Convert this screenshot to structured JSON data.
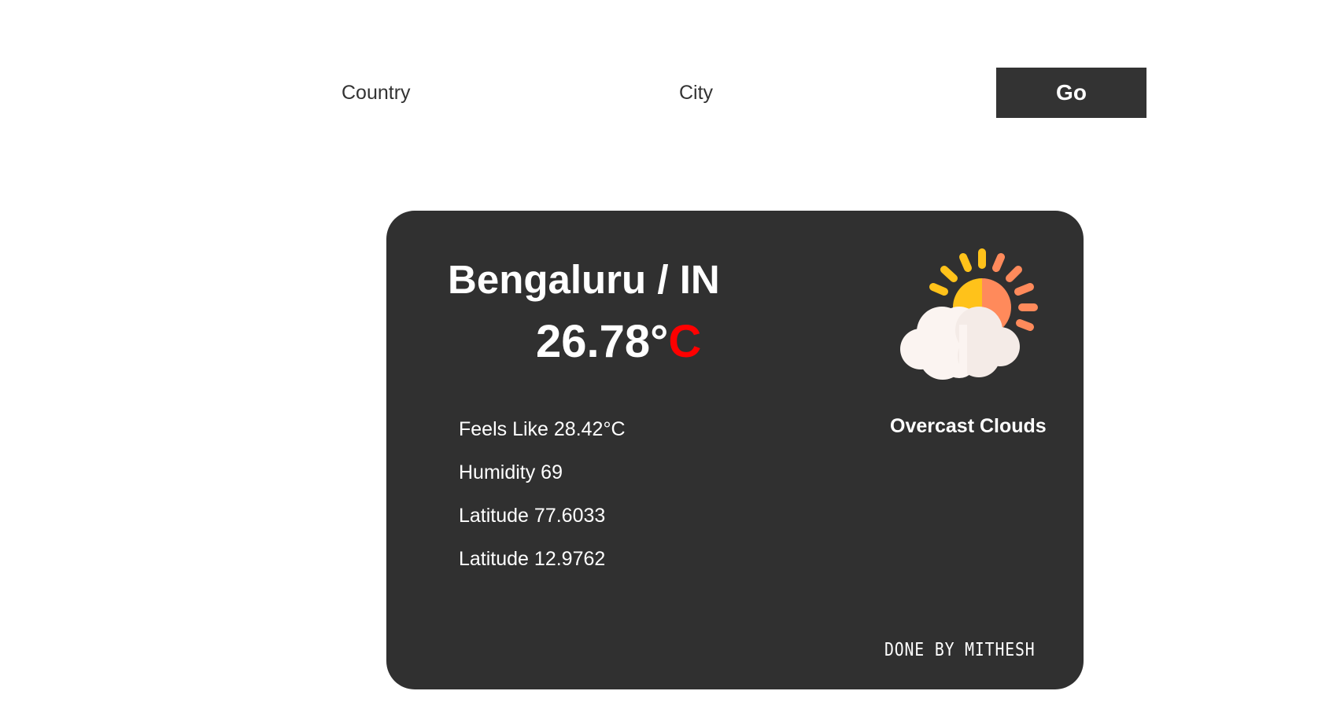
{
  "search": {
    "country_placeholder": "Country",
    "city_placeholder": "City",
    "go_label": "Go"
  },
  "weather": {
    "location": "Bengaluru / IN",
    "temperature_value": "26.78°",
    "temperature_unit": "C",
    "feels_like": "Feels Like 28.42°C",
    "humidity": "Humidity 69",
    "latitude_line_1": "Latitude 77.6033",
    "latitude_line_2": "Latitude 12.9762",
    "condition": "Overcast Clouds",
    "icon": "sun-behind-cloud-icon"
  },
  "footer": {
    "credit": "DONE BY MITHESH"
  },
  "colors": {
    "card_background": "#303030",
    "button_background": "#333333",
    "unit_accent": "#ff0000",
    "sun_yellow": "#FFC21A",
    "sun_orange": "#FF8A5B",
    "cloud_white": "#FBF4F1"
  }
}
